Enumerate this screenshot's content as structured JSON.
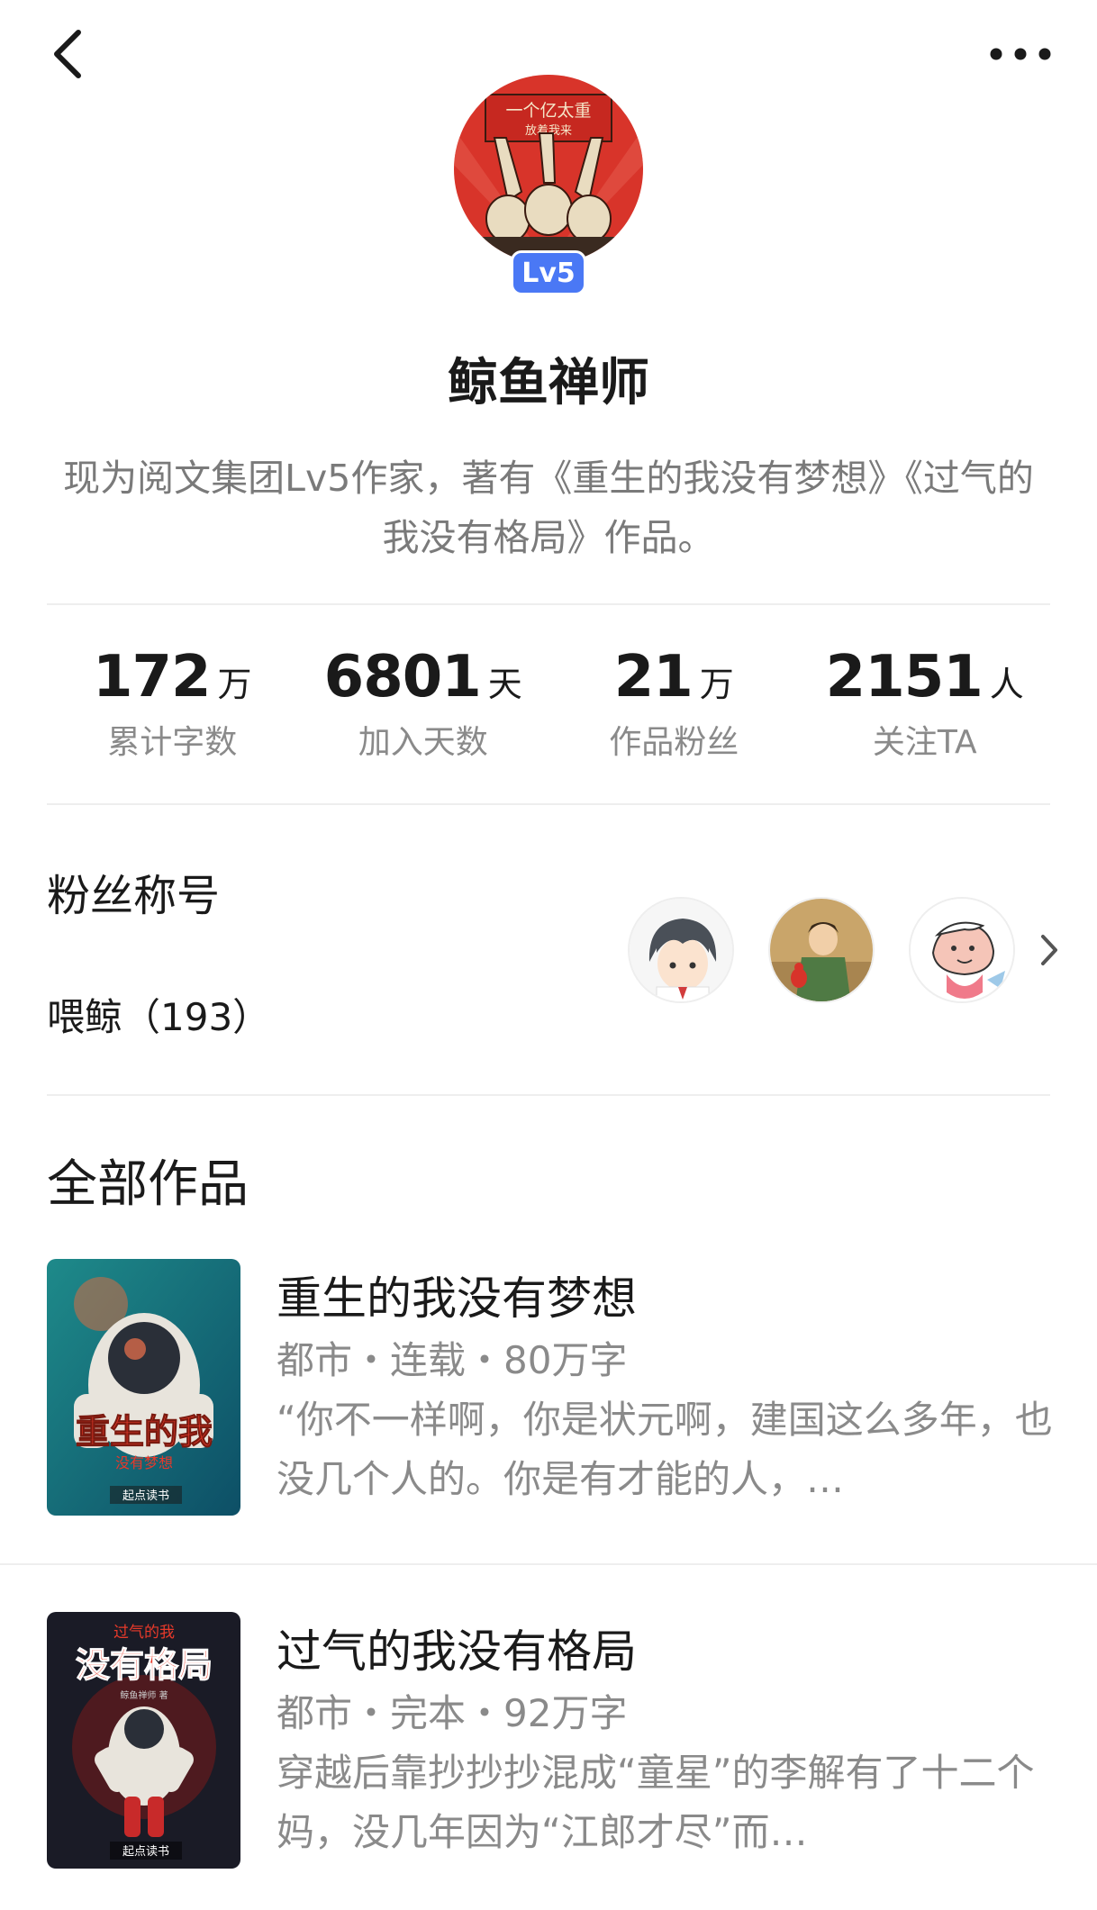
{
  "topbar": {
    "back_icon": "chevron-left-icon",
    "more_icon": "more-horizontal-icon"
  },
  "author": {
    "avatar_text_1": "一个亿太重",
    "avatar_text_2": "放着我来",
    "level": "Lv5",
    "name": "鲸鱼禅师",
    "bio": "现为阅文集团Lv5作家，著有《重生的我没有梦想》《过气的我没有格局》作品。"
  },
  "stats": [
    {
      "value": "172",
      "unit": "万",
      "label": "累计字数"
    },
    {
      "value": "6801",
      "unit": "天",
      "label": "加入天数"
    },
    {
      "value": "21",
      "unit": "万",
      "label": "作品粉丝"
    },
    {
      "value": "2151",
      "unit": "人",
      "label": "关注TA"
    }
  ],
  "fans": {
    "title": "粉丝称号",
    "nickname": "喂鲸（193）"
  },
  "works": {
    "title": "全部作品",
    "books": [
      {
        "title": "重生的我没有梦想",
        "meta": "都市・连载・80万字",
        "desc": "“你不一样啊，你是状元啊，建国这么多年，也没几个人的。你是有才能的人，…",
        "cover_title": "重生的我",
        "cover_subtitle": "没有梦想",
        "cover_brand": "起点读书"
      },
      {
        "title": "过气的我没有格局",
        "meta": "都市・完本・92万字",
        "desc": "穿越后靠抄抄抄混成“童星”的李解有了十二个妈，没几年因为“江郎才尽”而…",
        "cover_top": "过气的我",
        "cover_title": "没有格局",
        "cover_author": "鲸鱼禅师 著",
        "cover_brand": "起点读书"
      }
    ]
  },
  "colors": {
    "accent": "#4a78f5",
    "text": "#1a1a1a",
    "muted": "#8a8a8a",
    "divider": "#eeeeee"
  }
}
